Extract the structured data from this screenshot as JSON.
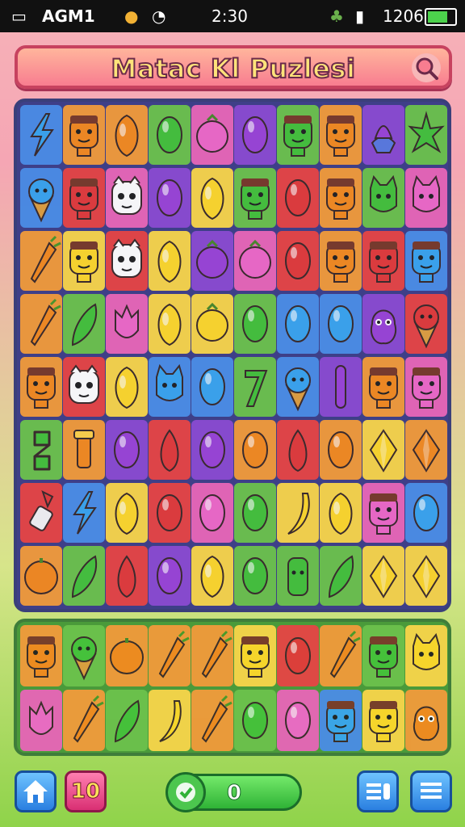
{
  "status_bar": {
    "carrier": "AGM1",
    "time": "2:30",
    "battery": "1206"
  },
  "header": {
    "title": "Matac Kl  Puzlesi",
    "search_icon": "magnifier-icon"
  },
  "colors": {
    "red": "#e33b3b",
    "orange": "#f58b1f",
    "yellow": "#ffd92b",
    "green": "#45c33b",
    "blue": "#3aa6f0",
    "purple": "#9b45d8",
    "pink": "#f06ac9",
    "board_border": "#3a3f7a"
  },
  "board": {
    "rows": [
      [
        "bolt",
        "face",
        "lemon",
        "egg",
        "berry",
        "egg",
        "face",
        "face",
        "swirl",
        "star"
      ],
      [
        "cone",
        "face",
        "ghost",
        "egg",
        "lemon",
        "face",
        "egg",
        "face",
        "cat",
        "cat"
      ],
      [
        "carrot",
        "face",
        "ghost",
        "lemon",
        "berry",
        "berry",
        "egg",
        "face",
        "face",
        "face"
      ],
      [
        "carrot",
        "leaf",
        "tulip",
        "lemon",
        "berry",
        "egg",
        "egg",
        "egg",
        "blob",
        "cone"
      ],
      [
        "face",
        "ghost",
        "lemon",
        "cat",
        "egg",
        "seven",
        "cone",
        "bar",
        "face",
        "face"
      ],
      [
        "eight",
        "tube",
        "egg",
        "drop",
        "egg",
        "egg",
        "drop",
        "egg",
        "diamond",
        "diamond"
      ],
      [
        "brush",
        "bolt",
        "lemon",
        "egg",
        "egg",
        "egg",
        "banana",
        "lemon",
        "face",
        "egg"
      ],
      [
        "orange",
        "leaf",
        "drop",
        "egg",
        "lemon",
        "egg",
        "cactus",
        "leaf",
        "diamond",
        "diamond"
      ]
    ],
    "colors": [
      [
        "blue",
        "orange",
        "orange",
        "green",
        "pink",
        "purple",
        "green",
        "orange",
        "purple",
        "green"
      ],
      [
        "blue",
        "red",
        "pink",
        "purple",
        "yellow",
        "green",
        "red",
        "orange",
        "green",
        "pink"
      ],
      [
        "orange",
        "yellow",
        "red",
        "yellow",
        "purple",
        "pink",
        "red",
        "orange",
        "red",
        "blue"
      ],
      [
        "orange",
        "green",
        "pink",
        "yellow",
        "yellow",
        "green",
        "blue",
        "blue",
        "purple",
        "red"
      ],
      [
        "orange",
        "red",
        "yellow",
        "blue",
        "blue",
        "green",
        "blue",
        "purple",
        "orange",
        "pink"
      ],
      [
        "green",
        "orange",
        "purple",
        "red",
        "purple",
        "orange",
        "red",
        "orange",
        "yellow",
        "orange"
      ],
      [
        "red",
        "blue",
        "yellow",
        "red",
        "pink",
        "green",
        "yellow",
        "yellow",
        "pink",
        "blue"
      ],
      [
        "orange",
        "green",
        "red",
        "purple",
        "yellow",
        "green",
        "green",
        "green",
        "yellow",
        "yellow"
      ]
    ]
  },
  "tray": {
    "rows": [
      [
        "face",
        "cone",
        "orange",
        "carrot",
        "carrot",
        "face",
        "egg",
        "carrot",
        "face",
        "cat"
      ],
      [
        "tulip",
        "carrot",
        "leaf",
        "banana",
        "carrot",
        "egg",
        "egg",
        "face",
        "face",
        "blob"
      ]
    ],
    "colors": [
      [
        "orange",
        "green",
        "orange",
        "orange",
        "orange",
        "yellow",
        "red",
        "orange",
        "green",
        "yellow"
      ],
      [
        "pink",
        "orange",
        "green",
        "yellow",
        "orange",
        "green",
        "pink",
        "blue",
        "yellow",
        "orange"
      ]
    ]
  },
  "bottom_bar": {
    "moves": "10",
    "score": "0",
    "home_icon": "home-icon",
    "list_icon": "list-icon",
    "menu_icon": "menu-icon"
  }
}
